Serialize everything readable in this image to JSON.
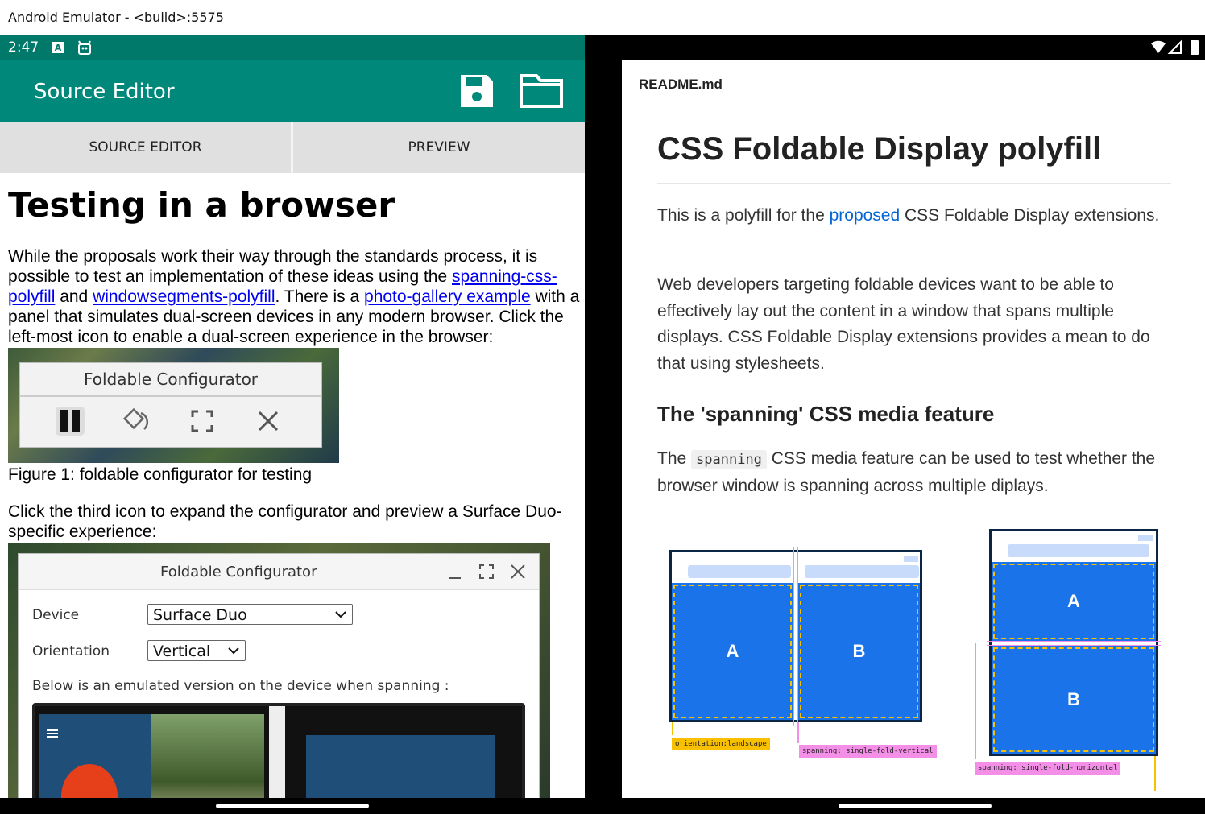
{
  "window": {
    "title": "Android Emulator - <build>:5575"
  },
  "status": {
    "time": "2:47"
  },
  "appbar": {
    "title": "Source Editor",
    "save_icon": "save-icon",
    "folder_icon": "folder-icon"
  },
  "tabs": [
    {
      "label": "SOURCE EDITOR"
    },
    {
      "label": "PREVIEW"
    }
  ],
  "left": {
    "heading": "Testing in a browser",
    "p1": {
      "t1": "While the proposals work their way through the standards process, it is possible to test an implementation of these ideas using the ",
      "link1": "spanning-css-polyfill",
      "t2": " and ",
      "link2": "windowsegments-polyfill",
      "t3": ". There is a ",
      "link3": "photo-gallery example",
      "t4": " with a panel that simulates dual-screen devices in any modern browser. Click the left-most icon to enable a dual-screen experience in the browser:"
    },
    "figure1": {
      "panel_title": "Foldable Configurator",
      "caption": "Figure 1: foldable configurator for testing"
    },
    "p2": "Click the third icon to expand the configurator and preview a Surface Duo-specific experience:",
    "figure2": {
      "title": "Foldable Configurator",
      "device_label": "Device",
      "device_value": "Surface Duo",
      "orientation_label": "Orientation",
      "orientation_value": "Vertical",
      "note": "Below is an emulated version on the device when spanning :"
    }
  },
  "right": {
    "filename": "README.md",
    "h1": "CSS Foldable Display polyfill",
    "p1_before": "This is a polyfill for the ",
    "p1_link": "proposed",
    "p1_after": " CSS Foldable Display extensions.",
    "p2": "Web developers targeting foldable devices want to be able to effectively lay out the content in a window that spans multiple displays. CSS Foldable Display extensions provides a mean to do that using stylesheets.",
    "h2": "The 'spanning' CSS media feature",
    "p3_before": "The ",
    "p3_code": "spanning",
    "p3_after": " CSS media feature can be used to test whether the browser window is spanning across multiple diplays.",
    "diagram": {
      "label_a": "A",
      "label_b": "B",
      "tag_landscape": "orientation:landscape",
      "tag_vertical": "spanning: single-fold-vertical",
      "tag_horizontal": "spanning: single-fold-horizontal",
      "colors": {
        "panel": "#1a73e8",
        "yellow": "#f9c000",
        "pink": "#f48fe8"
      }
    }
  }
}
